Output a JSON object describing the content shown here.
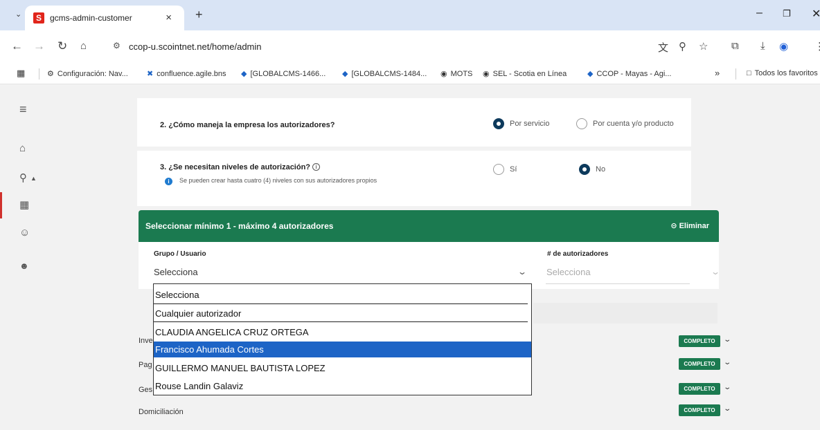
{
  "browser": {
    "tab_title": "gcms-admin-customer",
    "tab_close": "×",
    "new_tab": "+",
    "url": "ccop-u.scointnet.net/home/admin",
    "more_bookmarks": "»",
    "bookmarks": [
      {
        "label": "Configuración: Nav...",
        "icon": "gear-icon"
      },
      {
        "label": "confluence.agile.bns",
        "icon": "confluence-icon"
      },
      {
        "label": "[GLOBALCMS-1466...",
        "icon": "jira-icon"
      },
      {
        "label": "[GLOBALCMS-1484...",
        "icon": "jira-icon"
      },
      {
        "label": "MOTS",
        "icon": "globe-icon"
      },
      {
        "label": "SEL - Scotia en Línea",
        "icon": "globe-icon"
      },
      {
        "label": "CCOP - Mayas - Agi...",
        "icon": "jira-icon"
      }
    ],
    "all_bookmarks": "Todos los favoritos"
  },
  "questions": {
    "q2": {
      "text": "2. ¿Cómo maneja la empresa los autorizadores?",
      "options": [
        "Por servicio",
        "Por cuenta y/o producto"
      ],
      "selected": "Por servicio"
    },
    "q3": {
      "text": "3. ¿Se necesitan niveles de autorización?",
      "hint": "Se pueden crear hasta cuatro (4) niveles con sus autorizadores propios",
      "options": [
        "Sí",
        "No"
      ],
      "selected": "No"
    }
  },
  "authorizers": {
    "title": "Seleccionar mínimo 1 - máximo 4 autorizadores",
    "delete_label": "⊝ Eliminar",
    "group_label": "Grupo / Usuario",
    "group_value": "Selecciona",
    "count_label": "# de autorizadores",
    "count_placeholder": "Selecciona",
    "dropdown_options": [
      "Selecciona",
      "Cualquier autorizador",
      "CLAUDIA ANGELICA CRUZ ORTEGA",
      "Francisco Ahumada Cortes",
      "GUILLERMO MANUEL BAUTISTA LOPEZ",
      "Rouse Landin Galaviz"
    ],
    "highlighted_option": "Francisco Ahumada Cortes"
  },
  "services": [
    {
      "label": "Inve",
      "status": "COMPLETO"
    },
    {
      "label": "Pag",
      "status": "COMPLETO"
    },
    {
      "label": "Ges",
      "status": "COMPLETO"
    },
    {
      "label": "Domiciliación",
      "status": "COMPLETO"
    }
  ],
  "colors": {
    "brand_green": "#1b7a50",
    "selected_option": "#1d64c6",
    "radio_selected": "#0d3a5c"
  }
}
